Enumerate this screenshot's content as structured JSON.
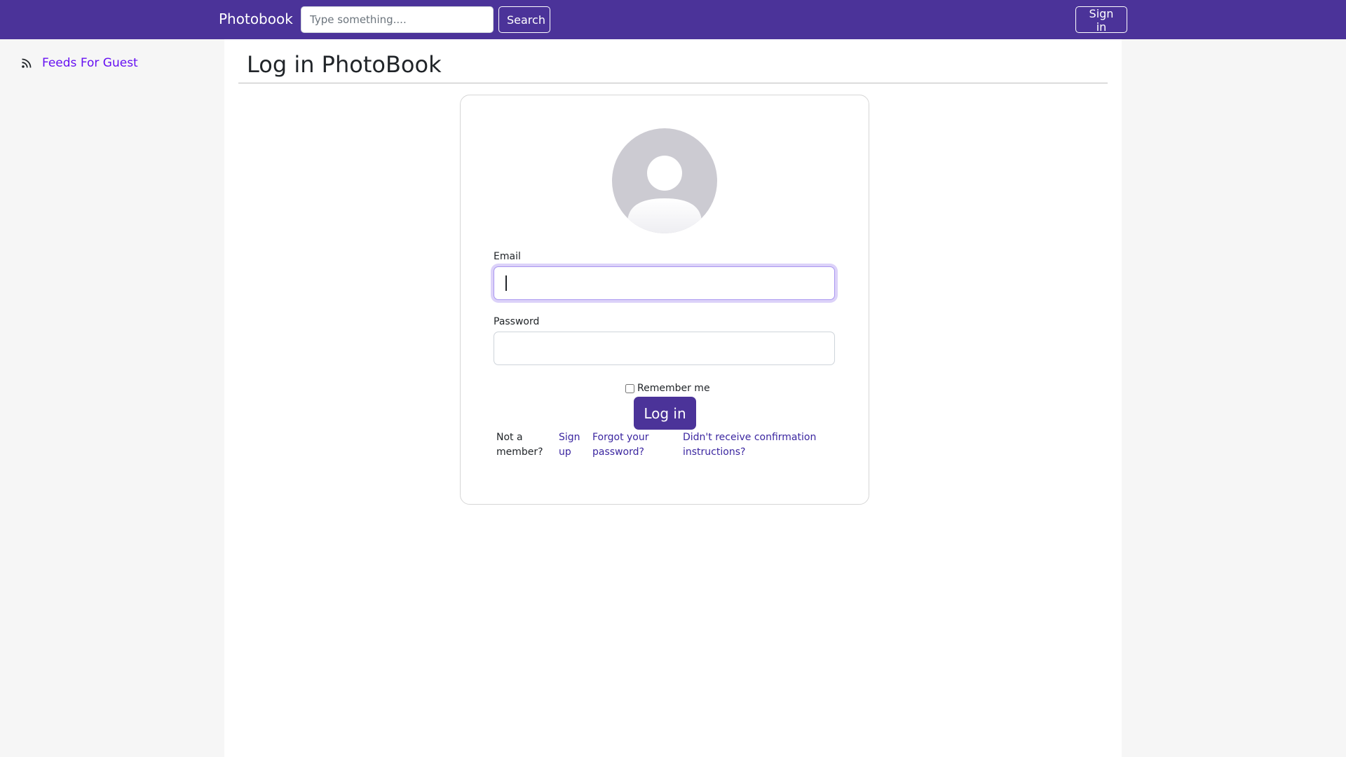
{
  "navbar": {
    "brand": "Photobook",
    "search_placeholder": "Type something....",
    "search_label": "Search",
    "signin_label": "Sign in"
  },
  "sidebar": {
    "items": [
      {
        "icon": "rss-icon",
        "label": "Feeds For Guest"
      }
    ]
  },
  "main": {
    "title": "Log in PhotoBook",
    "form": {
      "avatar_icon": "user-avatar-icon",
      "email_label": "Email",
      "email_value": "",
      "password_label": "Password",
      "password_value": "",
      "remember_label": "Remember me",
      "remember_checked": false,
      "submit_label": "Log in",
      "not_member_text": "Not a member?",
      "signup_label": "Sign up",
      "forgot_label": "Forgot your password?",
      "confirm_label": "Didn't receive confirmation instructions?"
    }
  },
  "colors": {
    "brand": "#4b3399",
    "sidebar_link": "#6610f2",
    "form_link": "#3b26a0",
    "avatar": "#cccbd2"
  }
}
